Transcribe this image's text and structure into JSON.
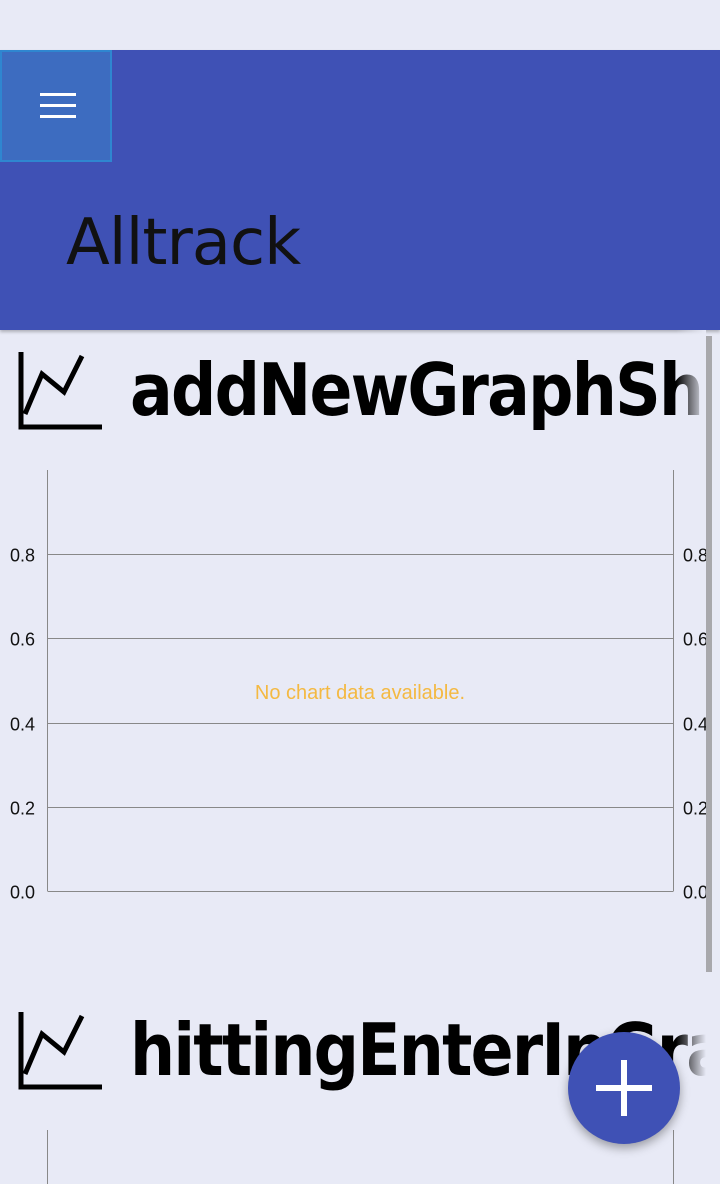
{
  "app": {
    "title": "Alltrack",
    "menu_icon": "hamburger-menu-icon"
  },
  "graphs": [
    {
      "title": "addNewGraphSh",
      "icon": "line-chart-icon",
      "chart_data": {
        "type": "line",
        "series": [],
        "ylim": [
          0,
          1
        ],
        "left_ticks": [
          "0.0",
          "0.2",
          "0.4",
          "0.6",
          "0.8"
        ],
        "right_ticks": [
          "0.0",
          "0.2",
          "0.4",
          "0.6",
          "0.8"
        ],
        "grid": true,
        "empty_message": "No chart data available.",
        "empty_message_color": "#f4b942"
      }
    },
    {
      "title": "hittingEnterInGra",
      "icon": "line-chart-icon"
    }
  ],
  "fab": {
    "icon": "plus-icon",
    "color": "#3f51b5"
  }
}
